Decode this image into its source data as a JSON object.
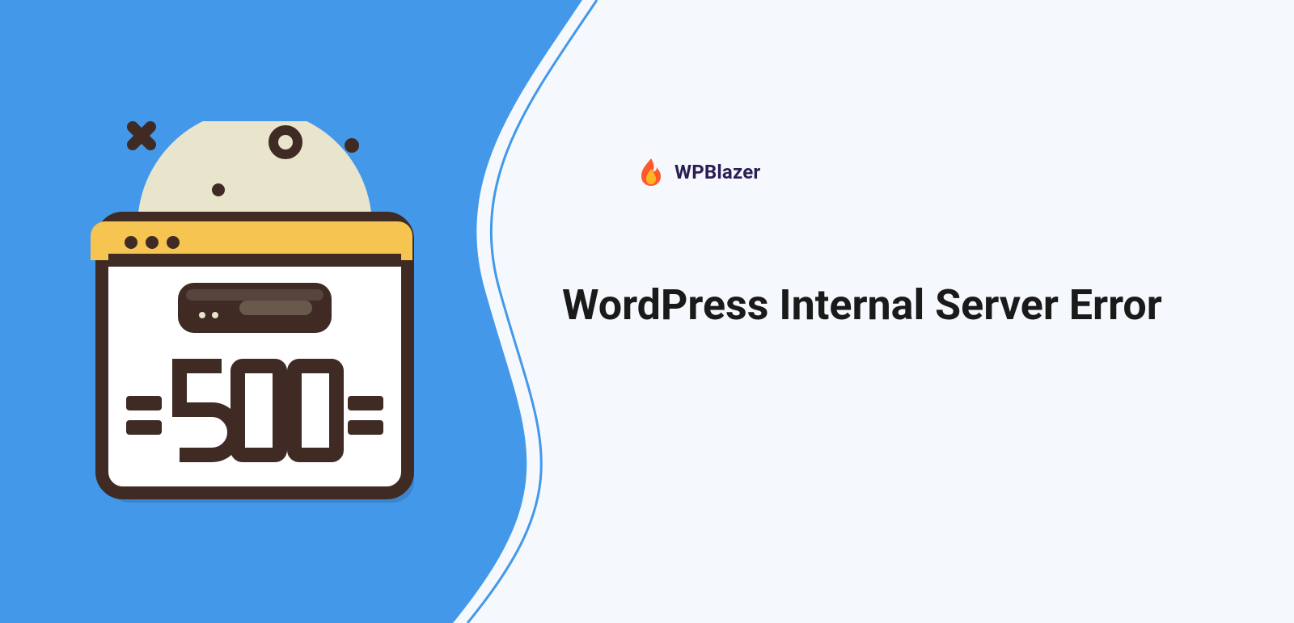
{
  "brand": {
    "name": "WPBlazer"
  },
  "headline": "WordPress Internal Server Error",
  "illustration": {
    "error_code": "500",
    "type": "server-error-browser-window"
  },
  "colors": {
    "blue": "#4398ea",
    "offwhite": "#f5f8fc",
    "beige": "#e9e4cc",
    "brown": "#3f2b23",
    "yellow": "#f6c451",
    "flame_outer": "#ff5a2c",
    "flame_inner": "#ffb526",
    "brand_text": "#2b1e55"
  }
}
